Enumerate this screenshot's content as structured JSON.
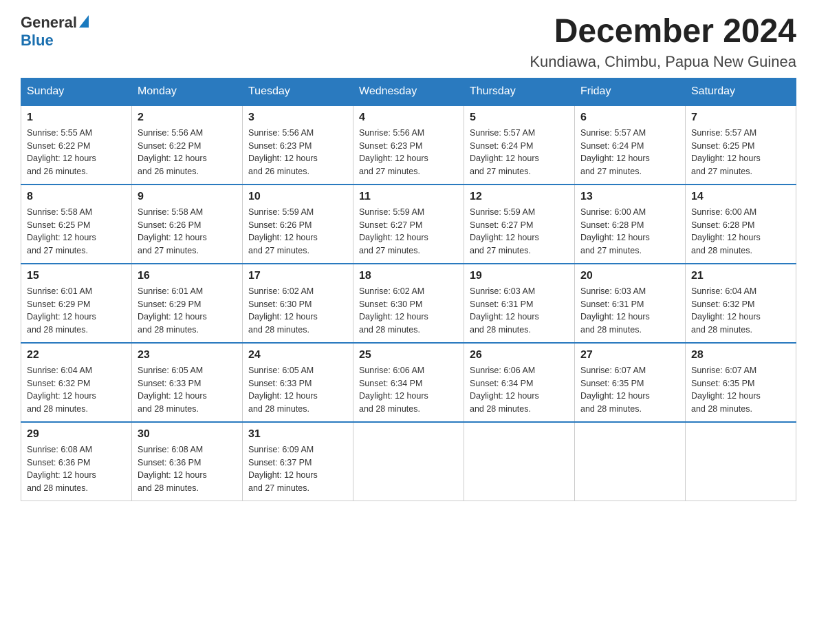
{
  "logo": {
    "text_general": "General",
    "text_blue": "Blue",
    "alt": "GeneralBlue logo"
  },
  "header": {
    "month_year": "December 2024",
    "location": "Kundiawa, Chimbu, Papua New Guinea"
  },
  "weekdays": [
    "Sunday",
    "Monday",
    "Tuesday",
    "Wednesday",
    "Thursday",
    "Friday",
    "Saturday"
  ],
  "weeks": [
    [
      {
        "day": "1",
        "sunrise": "5:55 AM",
        "sunset": "6:22 PM",
        "daylight": "12 hours and 26 minutes."
      },
      {
        "day": "2",
        "sunrise": "5:56 AM",
        "sunset": "6:22 PM",
        "daylight": "12 hours and 26 minutes."
      },
      {
        "day": "3",
        "sunrise": "5:56 AM",
        "sunset": "6:23 PM",
        "daylight": "12 hours and 26 minutes."
      },
      {
        "day": "4",
        "sunrise": "5:56 AM",
        "sunset": "6:23 PM",
        "daylight": "12 hours and 27 minutes."
      },
      {
        "day": "5",
        "sunrise": "5:57 AM",
        "sunset": "6:24 PM",
        "daylight": "12 hours and 27 minutes."
      },
      {
        "day": "6",
        "sunrise": "5:57 AM",
        "sunset": "6:24 PM",
        "daylight": "12 hours and 27 minutes."
      },
      {
        "day": "7",
        "sunrise": "5:57 AM",
        "sunset": "6:25 PM",
        "daylight": "12 hours and 27 minutes."
      }
    ],
    [
      {
        "day": "8",
        "sunrise": "5:58 AM",
        "sunset": "6:25 PM",
        "daylight": "12 hours and 27 minutes."
      },
      {
        "day": "9",
        "sunrise": "5:58 AM",
        "sunset": "6:26 PM",
        "daylight": "12 hours and 27 minutes."
      },
      {
        "day": "10",
        "sunrise": "5:59 AM",
        "sunset": "6:26 PM",
        "daylight": "12 hours and 27 minutes."
      },
      {
        "day": "11",
        "sunrise": "5:59 AM",
        "sunset": "6:27 PM",
        "daylight": "12 hours and 27 minutes."
      },
      {
        "day": "12",
        "sunrise": "5:59 AM",
        "sunset": "6:27 PM",
        "daylight": "12 hours and 27 minutes."
      },
      {
        "day": "13",
        "sunrise": "6:00 AM",
        "sunset": "6:28 PM",
        "daylight": "12 hours and 27 minutes."
      },
      {
        "day": "14",
        "sunrise": "6:00 AM",
        "sunset": "6:28 PM",
        "daylight": "12 hours and 28 minutes."
      }
    ],
    [
      {
        "day": "15",
        "sunrise": "6:01 AM",
        "sunset": "6:29 PM",
        "daylight": "12 hours and 28 minutes."
      },
      {
        "day": "16",
        "sunrise": "6:01 AM",
        "sunset": "6:29 PM",
        "daylight": "12 hours and 28 minutes."
      },
      {
        "day": "17",
        "sunrise": "6:02 AM",
        "sunset": "6:30 PM",
        "daylight": "12 hours and 28 minutes."
      },
      {
        "day": "18",
        "sunrise": "6:02 AM",
        "sunset": "6:30 PM",
        "daylight": "12 hours and 28 minutes."
      },
      {
        "day": "19",
        "sunrise": "6:03 AM",
        "sunset": "6:31 PM",
        "daylight": "12 hours and 28 minutes."
      },
      {
        "day": "20",
        "sunrise": "6:03 AM",
        "sunset": "6:31 PM",
        "daylight": "12 hours and 28 minutes."
      },
      {
        "day": "21",
        "sunrise": "6:04 AM",
        "sunset": "6:32 PM",
        "daylight": "12 hours and 28 minutes."
      }
    ],
    [
      {
        "day": "22",
        "sunrise": "6:04 AM",
        "sunset": "6:32 PM",
        "daylight": "12 hours and 28 minutes."
      },
      {
        "day": "23",
        "sunrise": "6:05 AM",
        "sunset": "6:33 PM",
        "daylight": "12 hours and 28 minutes."
      },
      {
        "day": "24",
        "sunrise": "6:05 AM",
        "sunset": "6:33 PM",
        "daylight": "12 hours and 28 minutes."
      },
      {
        "day": "25",
        "sunrise": "6:06 AM",
        "sunset": "6:34 PM",
        "daylight": "12 hours and 28 minutes."
      },
      {
        "day": "26",
        "sunrise": "6:06 AM",
        "sunset": "6:34 PM",
        "daylight": "12 hours and 28 minutes."
      },
      {
        "day": "27",
        "sunrise": "6:07 AM",
        "sunset": "6:35 PM",
        "daylight": "12 hours and 28 minutes."
      },
      {
        "day": "28",
        "sunrise": "6:07 AM",
        "sunset": "6:35 PM",
        "daylight": "12 hours and 28 minutes."
      }
    ],
    [
      {
        "day": "29",
        "sunrise": "6:08 AM",
        "sunset": "6:36 PM",
        "daylight": "12 hours and 28 minutes."
      },
      {
        "day": "30",
        "sunrise": "6:08 AM",
        "sunset": "6:36 PM",
        "daylight": "12 hours and 28 minutes."
      },
      {
        "day": "31",
        "sunrise": "6:09 AM",
        "sunset": "6:37 PM",
        "daylight": "12 hours and 27 minutes."
      },
      null,
      null,
      null,
      null
    ]
  ],
  "labels": {
    "sunrise": "Sunrise:",
    "sunset": "Sunset:",
    "daylight": "Daylight:"
  }
}
